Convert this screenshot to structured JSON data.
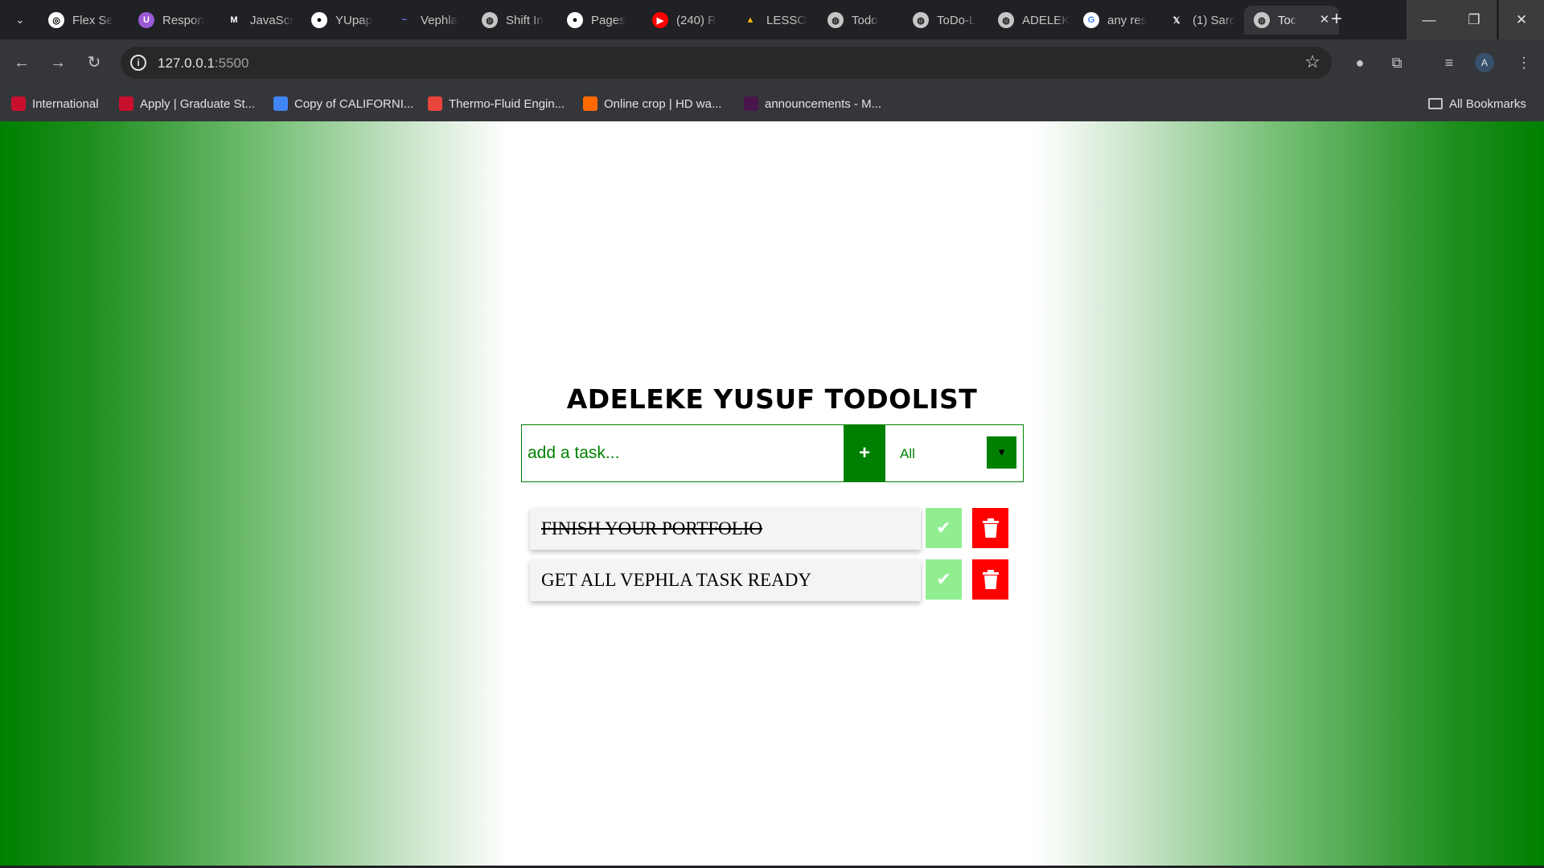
{
  "browser": {
    "tabs": [
      {
        "label": "Flex Se",
        "icon": "openai-icon",
        "fav_bg": "#ffffff",
        "fav_fg": "#000000",
        "glyph": "◎"
      },
      {
        "label": "Respon",
        "icon": "u-app-icon",
        "fav_bg": "#9b59d6",
        "fav_fg": "#ffffff",
        "glyph": "U"
      },
      {
        "label": "JavaScr",
        "icon": "m-letter-icon",
        "fav_bg": "transparent",
        "fav_fg": "#ffffff",
        "glyph": "M"
      },
      {
        "label": "YUpap",
        "icon": "github-icon",
        "fav_bg": "#ffffff",
        "fav_fg": "#000000",
        "glyph": "●"
      },
      {
        "label": "Vephla",
        "icon": "vephla-icon",
        "fav_bg": "transparent",
        "fav_fg": "#7d7dff",
        "glyph": "~"
      },
      {
        "label": "Shift In",
        "icon": "globe-icon",
        "fav_bg": "#c4c7c5",
        "fav_fg": "#202124",
        "glyph": "◍"
      },
      {
        "label": "Pages",
        "icon": "github-icon",
        "fav_bg": "#ffffff",
        "fav_fg": "#000000",
        "glyph": "●"
      },
      {
        "label": "(240) R",
        "icon": "youtube-icon",
        "fav_bg": "#ff0000",
        "fav_fg": "#ffffff",
        "glyph": "▶"
      },
      {
        "label": "LESSO",
        "icon": "google-drive-icon",
        "fav_bg": "transparent",
        "fav_fg": "#fbbc04",
        "glyph": "▲"
      },
      {
        "label": "Todo",
        "icon": "globe-icon",
        "fav_bg": "#c4c7c5",
        "fav_fg": "#202124",
        "glyph": "◍"
      },
      {
        "label": "ToDo-L",
        "icon": "globe-icon",
        "fav_bg": "#c4c7c5",
        "fav_fg": "#202124",
        "glyph": "◍"
      },
      {
        "label": "ADELEK",
        "icon": "globe-icon",
        "fav_bg": "#c4c7c5",
        "fav_fg": "#202124",
        "glyph": "◍"
      },
      {
        "label": "any res",
        "icon": "google-icon",
        "fav_bg": "#ffffff",
        "fav_fg": "#4285f4",
        "glyph": "G"
      },
      {
        "label": "(1) Sarc",
        "icon": "x-twitter-icon",
        "fav_bg": "transparent",
        "fav_fg": "#ffffff",
        "glyph": "𝕏"
      },
      {
        "label": "Toc",
        "icon": "globe-icon",
        "fav_bg": "#c4c7c5",
        "fav_fg": "#202124",
        "glyph": "◍",
        "active": true
      }
    ],
    "url_host": "127.0.0.1",
    "url_port": ":5500",
    "bookmarks": [
      {
        "label": "International",
        "icon": "wsu-icon",
        "color": "#c8102e"
      },
      {
        "label": "Apply | Graduate St...",
        "icon": "university-icon",
        "color": "#c8102e"
      },
      {
        "label": "Copy of CALIFORNI...",
        "icon": "google-docs-icon",
        "color": "#4285f4"
      },
      {
        "label": "Thermo-Fluid Engin...",
        "icon": "calendar-icon",
        "color": "#e8453c"
      },
      {
        "label": "Online crop | HD wa...",
        "icon": "flame-icon",
        "color": "#ff6a00"
      },
      {
        "label": "announcements - M...",
        "icon": "slack-icon",
        "color": "#4a154b"
      }
    ],
    "all_bookmarks": "All Bookmarks"
  },
  "app": {
    "title": "ADELEKE YUSUF TODOLIST",
    "input_placeholder": "add a task...",
    "add_label": "+",
    "filter_value": "All",
    "filter_arrow": "▼",
    "todos": [
      {
        "text": "FINISH YOUR PORTFOLIO",
        "completed": true
      },
      {
        "text": "GET ALL VEPHLA TASK READY",
        "completed": false
      }
    ]
  },
  "colors": {
    "accent": "#008000",
    "check": "#90ee90",
    "delete": "#ff0000"
  }
}
